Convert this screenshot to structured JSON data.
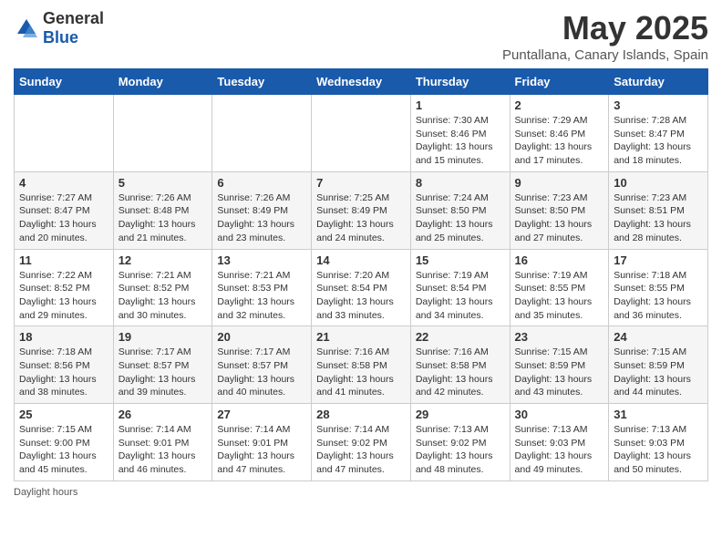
{
  "header": {
    "logo_general": "General",
    "logo_blue": "Blue",
    "title": "May 2025",
    "subtitle": "Puntallana, Canary Islands, Spain"
  },
  "calendar": {
    "days_of_week": [
      "Sunday",
      "Monday",
      "Tuesday",
      "Wednesday",
      "Thursday",
      "Friday",
      "Saturday"
    ],
    "weeks": [
      [
        {
          "day": "",
          "info": ""
        },
        {
          "day": "",
          "info": ""
        },
        {
          "day": "",
          "info": ""
        },
        {
          "day": "",
          "info": ""
        },
        {
          "day": "1",
          "info": "Sunrise: 7:30 AM\nSunset: 8:46 PM\nDaylight: 13 hours and 15 minutes."
        },
        {
          "day": "2",
          "info": "Sunrise: 7:29 AM\nSunset: 8:46 PM\nDaylight: 13 hours and 17 minutes."
        },
        {
          "day": "3",
          "info": "Sunrise: 7:28 AM\nSunset: 8:47 PM\nDaylight: 13 hours and 18 minutes."
        }
      ],
      [
        {
          "day": "4",
          "info": "Sunrise: 7:27 AM\nSunset: 8:47 PM\nDaylight: 13 hours and 20 minutes."
        },
        {
          "day": "5",
          "info": "Sunrise: 7:26 AM\nSunset: 8:48 PM\nDaylight: 13 hours and 21 minutes."
        },
        {
          "day": "6",
          "info": "Sunrise: 7:26 AM\nSunset: 8:49 PM\nDaylight: 13 hours and 23 minutes."
        },
        {
          "day": "7",
          "info": "Sunrise: 7:25 AM\nSunset: 8:49 PM\nDaylight: 13 hours and 24 minutes."
        },
        {
          "day": "8",
          "info": "Sunrise: 7:24 AM\nSunset: 8:50 PM\nDaylight: 13 hours and 25 minutes."
        },
        {
          "day": "9",
          "info": "Sunrise: 7:23 AM\nSunset: 8:50 PM\nDaylight: 13 hours and 27 minutes."
        },
        {
          "day": "10",
          "info": "Sunrise: 7:23 AM\nSunset: 8:51 PM\nDaylight: 13 hours and 28 minutes."
        }
      ],
      [
        {
          "day": "11",
          "info": "Sunrise: 7:22 AM\nSunset: 8:52 PM\nDaylight: 13 hours and 29 minutes."
        },
        {
          "day": "12",
          "info": "Sunrise: 7:21 AM\nSunset: 8:52 PM\nDaylight: 13 hours and 30 minutes."
        },
        {
          "day": "13",
          "info": "Sunrise: 7:21 AM\nSunset: 8:53 PM\nDaylight: 13 hours and 32 minutes."
        },
        {
          "day": "14",
          "info": "Sunrise: 7:20 AM\nSunset: 8:54 PM\nDaylight: 13 hours and 33 minutes."
        },
        {
          "day": "15",
          "info": "Sunrise: 7:19 AM\nSunset: 8:54 PM\nDaylight: 13 hours and 34 minutes."
        },
        {
          "day": "16",
          "info": "Sunrise: 7:19 AM\nSunset: 8:55 PM\nDaylight: 13 hours and 35 minutes."
        },
        {
          "day": "17",
          "info": "Sunrise: 7:18 AM\nSunset: 8:55 PM\nDaylight: 13 hours and 36 minutes."
        }
      ],
      [
        {
          "day": "18",
          "info": "Sunrise: 7:18 AM\nSunset: 8:56 PM\nDaylight: 13 hours and 38 minutes."
        },
        {
          "day": "19",
          "info": "Sunrise: 7:17 AM\nSunset: 8:57 PM\nDaylight: 13 hours and 39 minutes."
        },
        {
          "day": "20",
          "info": "Sunrise: 7:17 AM\nSunset: 8:57 PM\nDaylight: 13 hours and 40 minutes."
        },
        {
          "day": "21",
          "info": "Sunrise: 7:16 AM\nSunset: 8:58 PM\nDaylight: 13 hours and 41 minutes."
        },
        {
          "day": "22",
          "info": "Sunrise: 7:16 AM\nSunset: 8:58 PM\nDaylight: 13 hours and 42 minutes."
        },
        {
          "day": "23",
          "info": "Sunrise: 7:15 AM\nSunset: 8:59 PM\nDaylight: 13 hours and 43 minutes."
        },
        {
          "day": "24",
          "info": "Sunrise: 7:15 AM\nSunset: 8:59 PM\nDaylight: 13 hours and 44 minutes."
        }
      ],
      [
        {
          "day": "25",
          "info": "Sunrise: 7:15 AM\nSunset: 9:00 PM\nDaylight: 13 hours and 45 minutes."
        },
        {
          "day": "26",
          "info": "Sunrise: 7:14 AM\nSunset: 9:01 PM\nDaylight: 13 hours and 46 minutes."
        },
        {
          "day": "27",
          "info": "Sunrise: 7:14 AM\nSunset: 9:01 PM\nDaylight: 13 hours and 47 minutes."
        },
        {
          "day": "28",
          "info": "Sunrise: 7:14 AM\nSunset: 9:02 PM\nDaylight: 13 hours and 47 minutes."
        },
        {
          "day": "29",
          "info": "Sunrise: 7:13 AM\nSunset: 9:02 PM\nDaylight: 13 hours and 48 minutes."
        },
        {
          "day": "30",
          "info": "Sunrise: 7:13 AM\nSunset: 9:03 PM\nDaylight: 13 hours and 49 minutes."
        },
        {
          "day": "31",
          "info": "Sunrise: 7:13 AM\nSunset: 9:03 PM\nDaylight: 13 hours and 50 minutes."
        }
      ]
    ]
  },
  "footer": {
    "note": "Daylight hours"
  }
}
